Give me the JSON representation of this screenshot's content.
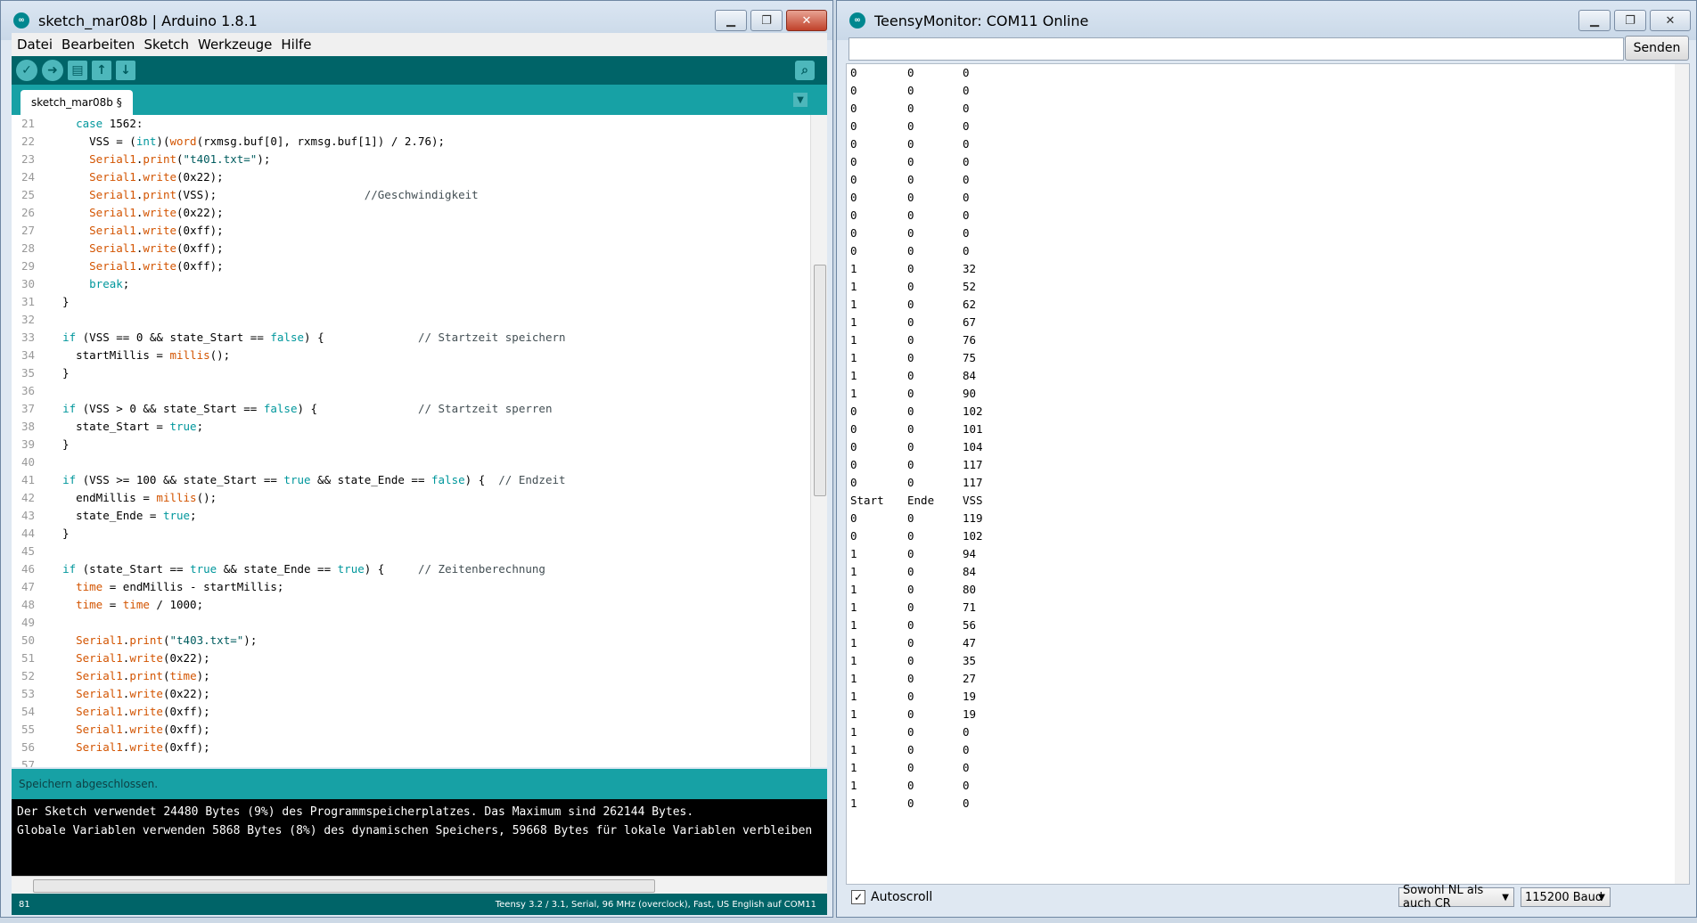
{
  "ide": {
    "title": "sketch_mar08b | Arduino 1.8.1",
    "menu": [
      "Datei",
      "Bearbeiten",
      "Sketch",
      "Werkzeuge",
      "Hilfe"
    ],
    "tab_name": "sketch_mar08b §",
    "code_lines": [
      {
        "n": "21",
        "html": "    <span class='kw'>case</span> 1562:"
      },
      {
        "n": "22",
        "html": "      VSS = (<span class='kw'>int</span>)(<span class='fn'>word</span>(rxmsg.buf[0], rxmsg.buf[1]) / 2.76);"
      },
      {
        "n": "23",
        "html": "      <span class='fn'>Serial1</span>.<span class='fn'>print</span>(<span class='str'>\"t401.txt=\"</span>);"
      },
      {
        "n": "24",
        "html": "      <span class='fn'>Serial1</span>.<span class='fn'>write</span>(0x22);"
      },
      {
        "n": "25",
        "html": "      <span class='fn'>Serial1</span>.<span class='fn'>print</span>(VSS);                      <span class='cm'>//Geschwindigkeit</span>"
      },
      {
        "n": "26",
        "html": "      <span class='fn'>Serial1</span>.<span class='fn'>write</span>(0x22);"
      },
      {
        "n": "27",
        "html": "      <span class='fn'>Serial1</span>.<span class='fn'>write</span>(0xff);"
      },
      {
        "n": "28",
        "html": "      <span class='fn'>Serial1</span>.<span class='fn'>write</span>(0xff);"
      },
      {
        "n": "29",
        "html": "      <span class='fn'>Serial1</span>.<span class='fn'>write</span>(0xff);"
      },
      {
        "n": "30",
        "html": "      <span class='kw'>break</span>;"
      },
      {
        "n": "31",
        "html": "  }"
      },
      {
        "n": "32",
        "html": ""
      },
      {
        "n": "33",
        "html": "  <span class='kw'>if</span> (VSS == 0 &amp;&amp; state_Start == <span class='kw'>false</span>) {              <span class='cm'>// Startzeit speichern</span>"
      },
      {
        "n": "34",
        "html": "    startMillis = <span class='fn'>millis</span>();"
      },
      {
        "n": "35",
        "html": "  }"
      },
      {
        "n": "36",
        "html": ""
      },
      {
        "n": "37",
        "html": "  <span class='kw'>if</span> (VSS &gt; 0 &amp;&amp; state_Start == <span class='kw'>false</span>) {               <span class='cm'>// Startzeit sperren</span>"
      },
      {
        "n": "38",
        "html": "    state_Start = <span class='kw'>true</span>;"
      },
      {
        "n": "39",
        "html": "  }"
      },
      {
        "n": "40",
        "html": ""
      },
      {
        "n": "41",
        "html": "  <span class='kw'>if</span> (VSS &gt;= 100 &amp;&amp; state_Start == <span class='kw'>true</span> &amp;&amp; state_Ende == <span class='kw'>false</span>) {  <span class='cm'>// Endzeit</span>"
      },
      {
        "n": "42",
        "html": "    endMillis = <span class='fn'>millis</span>();"
      },
      {
        "n": "43",
        "html": "    state_Ende = <span class='kw'>true</span>;"
      },
      {
        "n": "44",
        "html": "  }"
      },
      {
        "n": "45",
        "html": ""
      },
      {
        "n": "46",
        "html": "  <span class='kw'>if</span> (state_Start == <span class='kw'>true</span> &amp;&amp; state_Ende == <span class='kw'>true</span>) {     <span class='cm'>// Zeitenberechnung</span>"
      },
      {
        "n": "47",
        "html": "    <span class='fn'>time</span> = endMillis - startMillis;"
      },
      {
        "n": "48",
        "html": "    <span class='fn'>time</span> = <span class='fn'>time</span> / 1000;"
      },
      {
        "n": "49",
        "html": ""
      },
      {
        "n": "50",
        "html": "    <span class='fn'>Serial1</span>.<span class='fn'>print</span>(<span class='str'>\"t403.txt=\"</span>);"
      },
      {
        "n": "51",
        "html": "    <span class='fn'>Serial1</span>.<span class='fn'>write</span>(0x22);"
      },
      {
        "n": "52",
        "html": "    <span class='fn'>Serial1</span>.<span class='fn'>print</span>(<span class='fn'>time</span>);"
      },
      {
        "n": "53",
        "html": "    <span class='fn'>Serial1</span>.<span class='fn'>write</span>(0x22);"
      },
      {
        "n": "54",
        "html": "    <span class='fn'>Serial1</span>.<span class='fn'>write</span>(0xff);"
      },
      {
        "n": "55",
        "html": "    <span class='fn'>Serial1</span>.<span class='fn'>write</span>(0xff);"
      },
      {
        "n": "56",
        "html": "    <span class='fn'>Serial1</span>.<span class='fn'>write</span>(0xff);"
      },
      {
        "n": "57",
        "html": ""
      }
    ],
    "status_message": "Speichern abgeschlossen.",
    "console_lines": [
      "Der Sketch verwendet 24480 Bytes (9%) des Programmspeicherplatzes. Das Maximum sind 262144 Bytes.",
      "Globale Variablen verwenden 5868 Bytes (8%) des dynamischen Speichers, 59668 Bytes für lokale Variablen verbleiben"
    ],
    "footer_line": "81",
    "footer_board": "Teensy 3.2 / 3.1, Serial, 96 MHz (overclock), Fast, US English auf COM11"
  },
  "monitor": {
    "title": "TeensyMonitor: COM11 Online",
    "input_value": "",
    "send_label": "Senden",
    "rows": [
      [
        "0",
        "0",
        "0"
      ],
      [
        "0",
        "0",
        "0"
      ],
      [
        "0",
        "0",
        "0"
      ],
      [
        "0",
        "0",
        "0"
      ],
      [
        "0",
        "0",
        "0"
      ],
      [
        "0",
        "0",
        "0"
      ],
      [
        "0",
        "0",
        "0"
      ],
      [
        "0",
        "0",
        "0"
      ],
      [
        "0",
        "0",
        "0"
      ],
      [
        "0",
        "0",
        "0"
      ],
      [
        "0",
        "0",
        "0"
      ],
      [
        "1",
        "0",
        "32"
      ],
      [
        "1",
        "0",
        "52"
      ],
      [
        "1",
        "0",
        "62"
      ],
      [
        "1",
        "0",
        "67"
      ],
      [
        "1",
        "0",
        "76"
      ],
      [
        "1",
        "0",
        "75"
      ],
      [
        "1",
        "0",
        "84"
      ],
      [
        "1",
        "0",
        "90"
      ],
      [
        "0",
        "0",
        "102"
      ],
      [
        "0",
        "0",
        "101"
      ],
      [
        "0",
        "0",
        "104"
      ],
      [
        "0",
        "0",
        "117"
      ],
      [
        "0",
        "0",
        "117"
      ],
      [
        "Start",
        "Ende",
        "VSS"
      ],
      [
        "0",
        "0",
        "119"
      ],
      [
        "0",
        "0",
        "102"
      ],
      [
        "1",
        "0",
        "94"
      ],
      [
        "1",
        "0",
        "84"
      ],
      [
        "1",
        "0",
        "80"
      ],
      [
        "1",
        "0",
        "71"
      ],
      [
        "1",
        "0",
        "56"
      ],
      [
        "1",
        "0",
        "47"
      ],
      [
        "1",
        "0",
        "35"
      ],
      [
        "1",
        "0",
        "27"
      ],
      [
        "1",
        "0",
        "19"
      ],
      [
        "1",
        "0",
        "19"
      ],
      [
        "1",
        "0",
        "0"
      ],
      [
        "1",
        "0",
        "0"
      ],
      [
        "1",
        "0",
        "0"
      ],
      [
        "1",
        "0",
        "0"
      ],
      [
        "1",
        "0",
        "0"
      ]
    ],
    "autoscroll_label": "Autoscroll",
    "autoscroll_checked": true,
    "line_ending": "Sowohl NL als auch CR",
    "baud": "115200 Baud"
  }
}
